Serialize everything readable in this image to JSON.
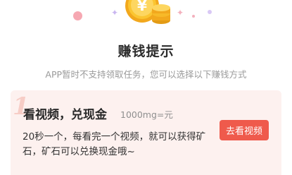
{
  "header": {
    "icon": "gold-coin-stack-icon",
    "coin_symbol": "¥",
    "title": "赚钱提示",
    "subtitle": "APP暂时不支持领取任务，您可以选择以下赚钱方式"
  },
  "tasks": [
    {
      "index": "1",
      "title": "看视频，兑现金",
      "rate": "1000mg=元",
      "description": "20秒一个，每看完一个视频，就可以获得矿石，矿石可以兑换现金哦~",
      "button_label": "去看视频"
    }
  ],
  "colors": {
    "accent": "#ef5a4c",
    "card_background": "#fdf1ef",
    "coin_gold": "#f7b928"
  }
}
